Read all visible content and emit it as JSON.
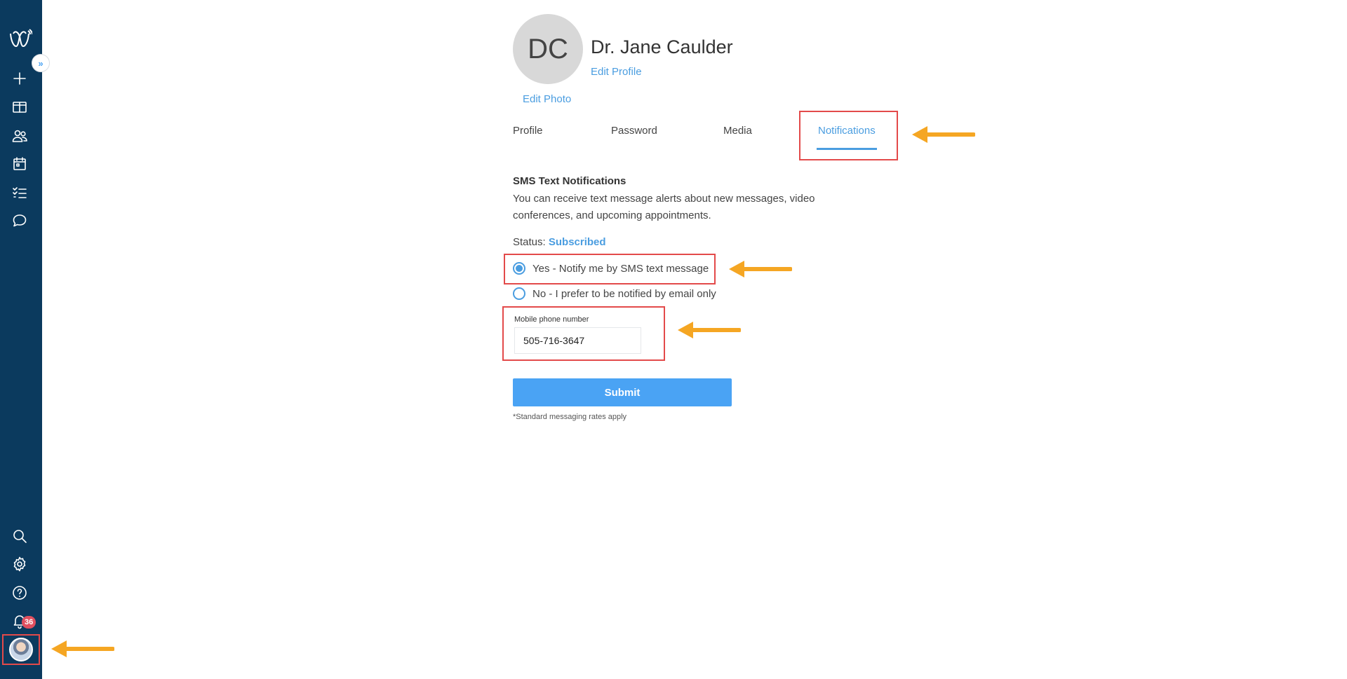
{
  "sidebar": {
    "expand_label": "»",
    "notification_count": "36",
    "icons": [
      "logo-icon",
      "plus-icon",
      "columns-icon",
      "users-icon",
      "calendar-icon",
      "checklist-icon",
      "chat-icon",
      "search-icon",
      "gear-icon",
      "help-icon",
      "bell-icon"
    ]
  },
  "profile": {
    "initials": "DC",
    "name": "Dr. Jane Caulder",
    "edit_profile": "Edit Profile",
    "edit_photo": "Edit Photo"
  },
  "tabs": [
    {
      "label": "Profile",
      "active": false
    },
    {
      "label": "Password",
      "active": false
    },
    {
      "label": "Media",
      "active": false
    },
    {
      "label": "Notifications",
      "active": true
    }
  ],
  "sms": {
    "title": "SMS Text Notifications",
    "description": "You can receive text message alerts about new messages, video conferences, and upcoming appointments.",
    "status_label": "Status:",
    "status_value": "Subscribed",
    "option_yes": "Yes - Notify me by SMS text message",
    "option_no": "No - I prefer to be notified by email only",
    "selected": "yes",
    "phone_label": "Mobile phone number",
    "phone_value": "505-716-3647",
    "submit_label": "Submit",
    "rates_note": "*Standard messaging rates apply"
  },
  "colors": {
    "sidebar_bg": "#0b3a5e",
    "accent": "#4a9de0",
    "button": "#4aa3f4",
    "highlight": "#e34a4a",
    "arrow": "#f5a623",
    "badge": "#e04f5f"
  }
}
